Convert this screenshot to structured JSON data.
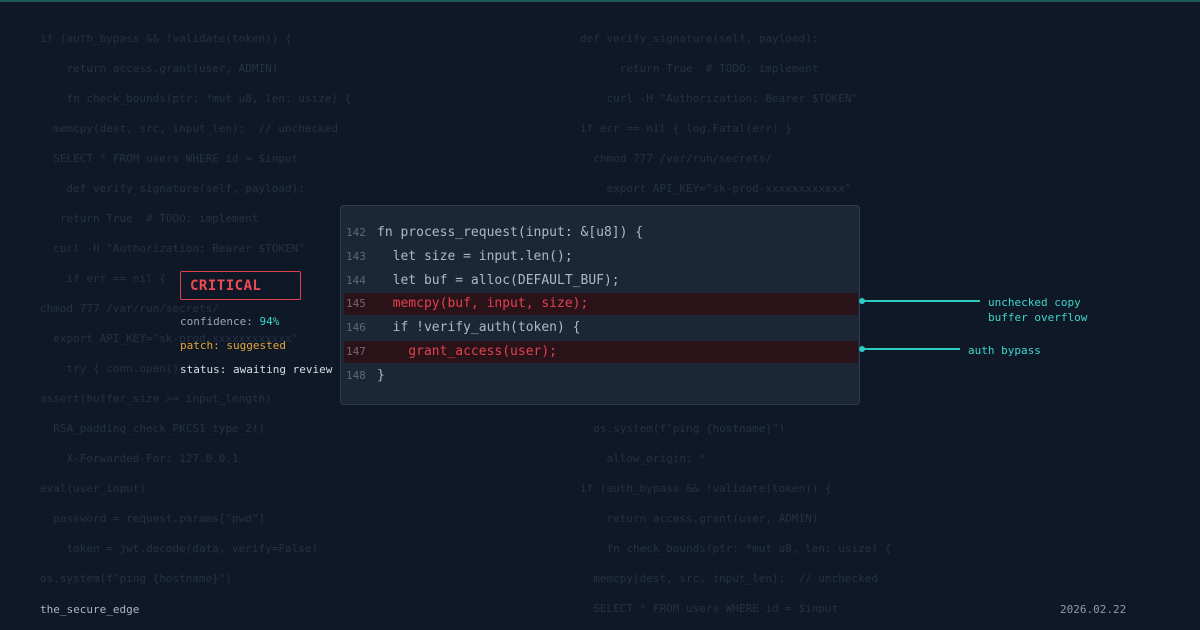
{
  "background_code": {
    "left": [
      "if (auth_bypass && !validate(token)) {",
      "    return access.grant(user, ADMIN)",
      "    fn check_bounds(ptr: *mut u8, len: usize) {",
      "  memcpy(dest, src, input_len);  // unchecked",
      "  SELECT * FROM users WHERE id = $input",
      "    def verify_signature(self, payload):",
      "   return True  # TODO: implement",
      "  curl -H \"Authorization: Bearer $TOKEN\"",
      "    if err == nil {",
      "chmod 777 /var/run/secrets/",
      "  export API_KEY=\"sk-prod-xxxxxxxxxxxx\"",
      "    try { conn.open(); }",
      "assert(buffer_size >= input_length)",
      "  RSA_padding_check_PKCS1_type_2()",
      "    X-Forwarded-For: 127.0.0.1",
      "eval(user_input)",
      "  password = request.params[\"pwd\"]",
      "    token = jwt.decode(data, verify=False)",
      "os.system(f\"ping {hostname}\")"
    ],
    "right": [
      "def verify_signature(self, payload):",
      "      return True  # TODO: implement",
      "    curl -H \"Authorization: Bearer $TOKEN\"",
      "if err == nil { log.Fatal(err) }",
      "  chmod 777 /var/run/secrets/",
      "    export API_KEY=\"sk-prod-xxxxxxxxxxxx\"",
      "",
      "",
      "",
      "",
      "",
      "",
      "",
      "  os.system(f\"ping {hostname}\")",
      "    allow_origin: *",
      "if (auth_bypass && !validate(token)) {",
      "    return access.grant(user, ADMIN)",
      "    fn check_bounds(ptr: *mut u8, len: usize) {",
      "  memcpy(dest, src, input_len);  // unchecked",
      "  SELECT * FROM users WHERE id = $input"
    ]
  },
  "code_panel": {
    "lines": [
      {
        "num": "142",
        "text": "fn process_request(input: &[u8]) {",
        "highlight": false
      },
      {
        "num": "143",
        "text": "  let size = input.len();",
        "highlight": false
      },
      {
        "num": "144",
        "text": "  let buf = alloc(DEFAULT_BUF);",
        "highlight": false
      },
      {
        "num": "145",
        "text": "  memcpy(buf, input, size);",
        "highlight": true
      },
      {
        "num": "146",
        "text": "  if !verify_auth(token) {",
        "highlight": false
      },
      {
        "num": "147",
        "text": "    grant_access(user);",
        "highlight": true
      },
      {
        "num": "148",
        "text": "}",
        "highlight": false
      }
    ]
  },
  "callouts": [
    {
      "line1": "unchecked copy",
      "line2": "buffer overflow"
    },
    {
      "line1": "auth bypass",
      "line2": ""
    }
  ],
  "severity": {
    "badge": "CRITICAL",
    "confidence_label": "confidence:",
    "confidence_value": "94%",
    "patch_label": "patch:",
    "patch_value": "suggested",
    "status_label": "status:",
    "status_value": "awaiting review"
  },
  "footer": {
    "brand": "the_secure_edge",
    "date": "2026.02.22"
  },
  "colors": {
    "background": "#0f1826",
    "panel": "#1b2636",
    "critical": "#e0424f",
    "accent": "#2fc9c0",
    "patch": "#e3a53a"
  }
}
